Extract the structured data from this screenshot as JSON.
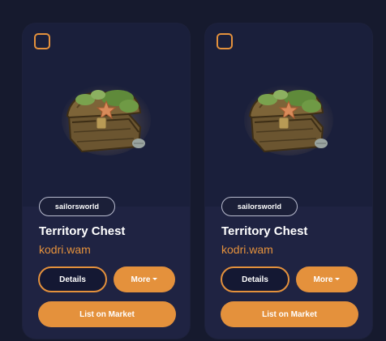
{
  "cards": [
    {
      "collection": "sailorsworld",
      "title": "Territory Chest",
      "owner": "kodri.wam",
      "details_label": "Details",
      "more_label": "More",
      "list_label": "List on Market",
      "image_icon": "treasure-chest-icon"
    },
    {
      "collection": "sailorsworld",
      "title": "Territory Chest",
      "owner": "kodri.wam",
      "details_label": "Details",
      "more_label": "More",
      "list_label": "List on Market",
      "image_icon": "treasure-chest-icon"
    }
  ],
  "colors": {
    "page_bg": "#161a2e",
    "card_bg": "#1f2342",
    "accent": "#e4913c",
    "text": "#ffffff"
  }
}
